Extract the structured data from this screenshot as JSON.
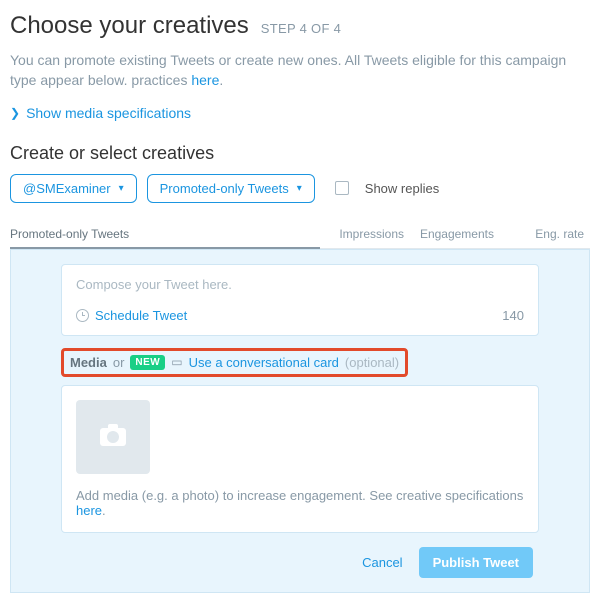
{
  "header": {
    "title": "Choose your creatives",
    "step_label": "STEP 4 OF 4",
    "intro_prefix": "You can promote existing Tweets or create new ones. All Tweets eligible for this campaign type appear below. practices ",
    "intro_link": "here",
    "intro_suffix": "."
  },
  "disclosure": {
    "label": "Show media specifications"
  },
  "section": {
    "title": "Create or select creatives"
  },
  "filters": {
    "account_pill": "@SMExaminer",
    "type_pill": "Promoted-only Tweets",
    "show_replies_label": "Show replies",
    "show_replies_checked": false
  },
  "columns": {
    "tweets_tab": "Promoted-only Tweets",
    "impressions": "Impressions",
    "engagements": "Engagements",
    "eng_rate": "Eng. rate"
  },
  "composer": {
    "placeholder": "Compose your Tweet here.",
    "schedule_label": "Schedule Tweet",
    "char_count": "140",
    "media_label": "Media",
    "or_text": "or",
    "new_badge": "NEW",
    "conv_card_link": "Use a conversational card",
    "optional_text": "(optional)",
    "media_help_prefix": "Add media (e.g. a photo) to increase engagement. See creative specifications ",
    "media_help_link": "here",
    "media_help_suffix": "."
  },
  "actions": {
    "cancel": "Cancel",
    "publish": "Publish Tweet"
  }
}
